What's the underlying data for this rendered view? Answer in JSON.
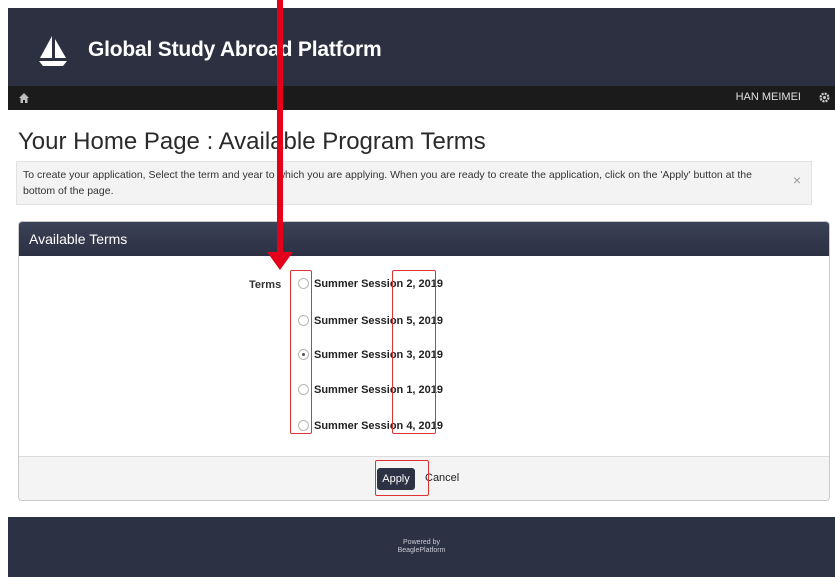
{
  "header": {
    "title": "Global Study Abroad Platform"
  },
  "nav": {
    "user_name": "HAN MEIMEI"
  },
  "page": {
    "title": "Your Home Page : Available Program Terms",
    "info_message": "To create your application, Select the term and year to which you are applying. When you are ready to create the application, click on the 'Apply' button at the bottom of the page.",
    "close_symbol": "×"
  },
  "panel": {
    "heading": "Available Terms",
    "terms_label": "Terms",
    "terms": [
      {
        "label": "Summer Session 2, 2019",
        "selected": false
      },
      {
        "label": "Summer Session 5, 2019",
        "selected": false
      },
      {
        "label": "Summer Session 3, 2019",
        "selected": true
      },
      {
        "label": "Summer Session 1, 2019",
        "selected": false
      },
      {
        "label": "Summer Session 4, 2019",
        "selected": false
      }
    ],
    "apply_label": "Apply",
    "cancel_label": "Cancel"
  },
  "footer": {
    "line1": "Powered by",
    "line2": "BeaglePlatform"
  },
  "colors": {
    "header_bg": "#2c3040",
    "nav_bg": "#1b1b1b",
    "annotation_red": "#e3001b"
  },
  "icons": [
    "sailboat-logo-icon",
    "home-icon",
    "gear-icon",
    "close-icon"
  ]
}
